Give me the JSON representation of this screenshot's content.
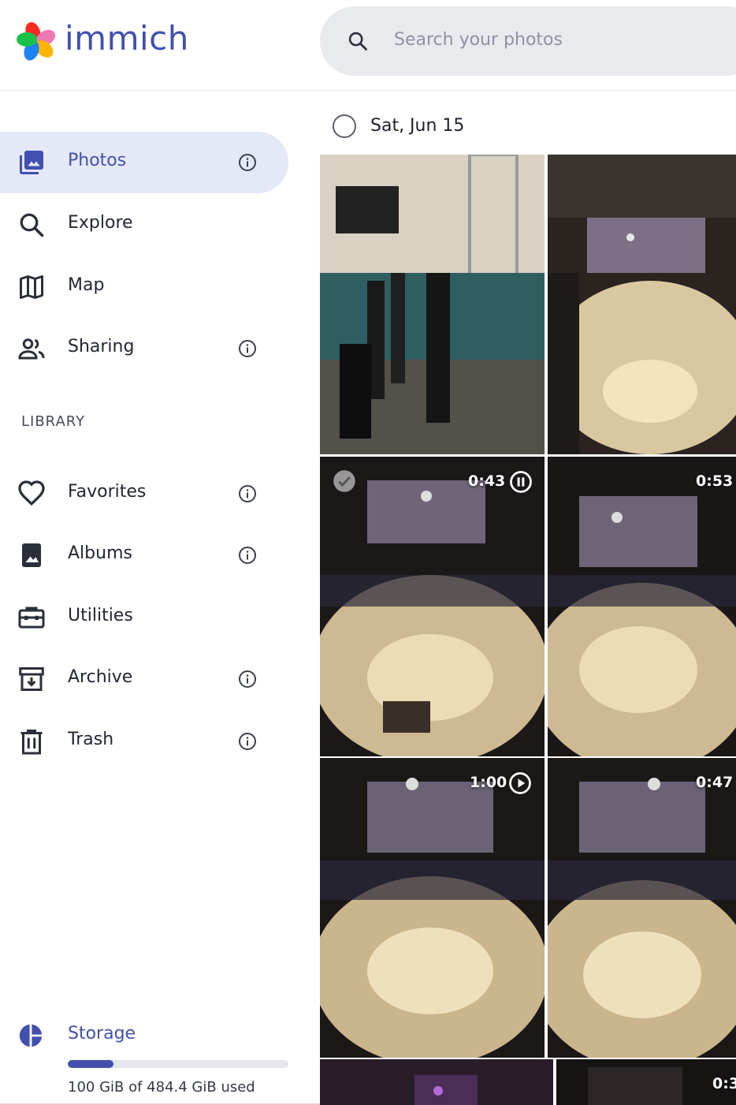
{
  "header": {
    "brand": "immich",
    "search": {
      "placeholder": "Search your photos",
      "icon": "search-icon"
    }
  },
  "sidebar": {
    "items": [
      {
        "label": "Photos",
        "icon": "photos-icon",
        "active": true,
        "info": true
      },
      {
        "label": "Explore",
        "icon": "search-icon",
        "active": false,
        "info": false
      },
      {
        "label": "Map",
        "icon": "map-icon",
        "active": false,
        "info": false
      },
      {
        "label": "Sharing",
        "icon": "people-icon",
        "active": false,
        "info": true
      }
    ],
    "library_title": "LIBRARY",
    "library": [
      {
        "label": "Favorites",
        "icon": "heart-icon",
        "info": true
      },
      {
        "label": "Albums",
        "icon": "album-icon",
        "info": true
      },
      {
        "label": "Utilities",
        "icon": "toolbox-icon",
        "info": false
      },
      {
        "label": "Archive",
        "icon": "archive-icon",
        "info": true
      },
      {
        "label": "Trash",
        "icon": "trash-icon",
        "info": true
      }
    ],
    "storage": {
      "label": "Storage",
      "used_text": "100 GiB of 484.4 GiB used",
      "used_fraction": 0.206
    }
  },
  "timeline": {
    "date_label": "Sat, Jun 15",
    "tiles": [
      {
        "kind": "photo"
      },
      {
        "kind": "photo"
      },
      {
        "kind": "video",
        "duration": "0:43",
        "control": "pause-icon",
        "selected": true
      },
      {
        "kind": "video",
        "duration": "0:53"
      },
      {
        "kind": "video",
        "duration": "1:00",
        "control": "play-icon"
      },
      {
        "kind": "video",
        "duration": "0:47"
      },
      {
        "kind": "photo"
      },
      {
        "kind": "video",
        "duration": "0:3"
      }
    ]
  },
  "colors": {
    "accent": "#4250af",
    "active_bg": "#e5e8f7",
    "search_bg": "#e9eaee"
  }
}
